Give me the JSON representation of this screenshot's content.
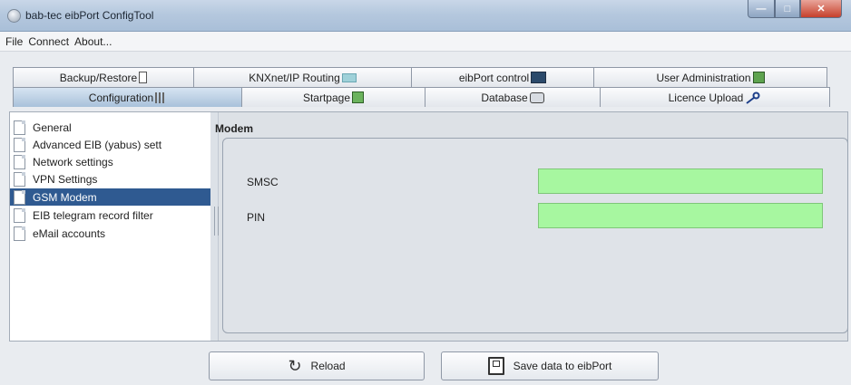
{
  "window": {
    "title": "bab-tec eibPort ConfigTool"
  },
  "menu": [
    "File",
    "Connect",
    "About..."
  ],
  "tabs_top": [
    {
      "label": "Backup/Restore",
      "icon": "disk-icon"
    },
    {
      "label": "KNXnet/IP Routing",
      "icon": "knx-icon"
    },
    {
      "label": "eibPort control",
      "icon": "computer-icon"
    },
    {
      "label": "User Administration",
      "icon": "user-admin-icon"
    }
  ],
  "tabs_bottom": [
    {
      "label": "Configuration",
      "icon": "config-icon"
    },
    {
      "label": "Startpage",
      "icon": "startpage-icon"
    },
    {
      "label": "Database",
      "icon": "database-icon"
    },
    {
      "label": "Licence Upload",
      "icon": "key-icon"
    }
  ],
  "tree": {
    "items": [
      "General",
      "Advanced EIB (yabus) sett",
      "Network settings",
      "VPN Settings",
      "GSM Modem",
      "EIB telegram record filter",
      "eMail accounts"
    ],
    "selected": "GSM Modem"
  },
  "panel": {
    "title": "Modem",
    "fields": [
      {
        "label": "SMSC",
        "value": ""
      },
      {
        "label": "PIN",
        "value": ""
      }
    ],
    "field_color": "#a7f7a0"
  },
  "buttons": {
    "reload": "Reload",
    "save": "Save data to eibPort"
  },
  "colors": {
    "selection": "#2f5a91",
    "active_tab": "#a9c1da"
  }
}
